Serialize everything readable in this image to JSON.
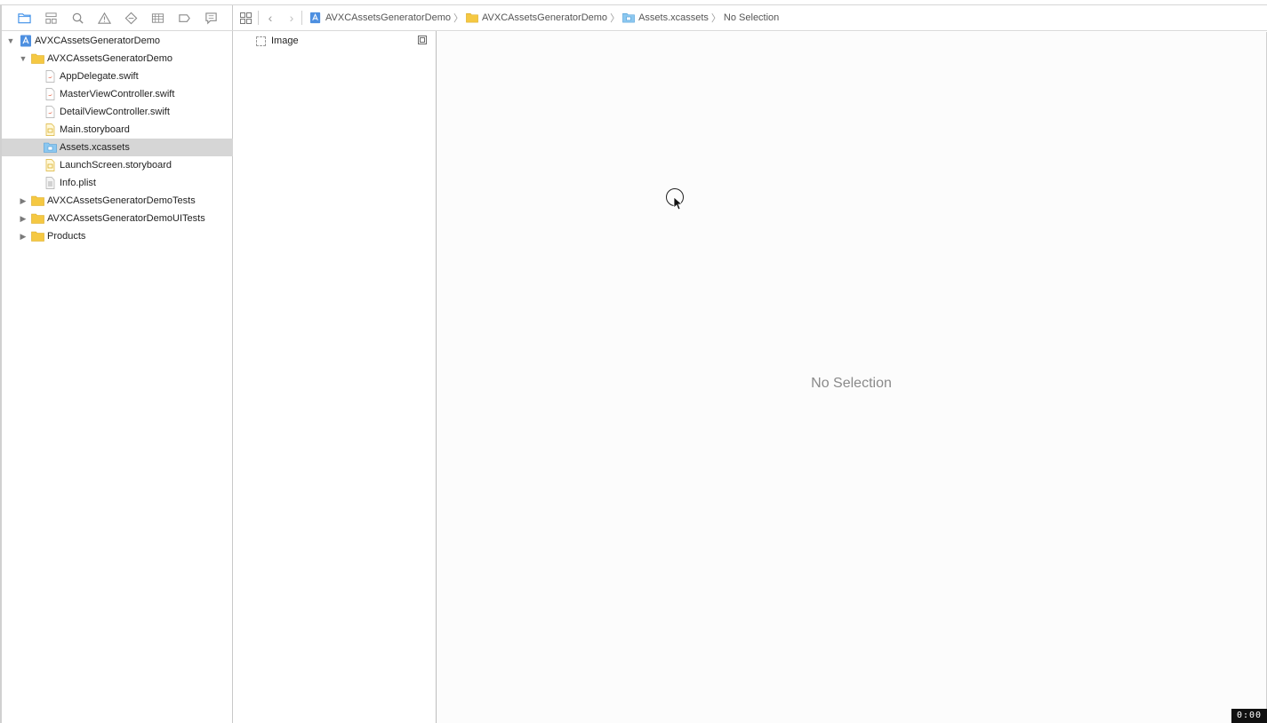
{
  "navigator": {
    "toolbar_icons": [
      "folder-icon",
      "hierarchy-icon",
      "search-icon",
      "warning-icon",
      "diamond-icon",
      "tests-icon",
      "breakpoint-icon",
      "report-icon"
    ],
    "items": [
      {
        "label": "AVXCAssetsGeneratorDemo",
        "type": "project",
        "level": 0,
        "disclosure": "open"
      },
      {
        "label": "AVXCAssetsGeneratorDemo",
        "type": "folder",
        "level": 1,
        "disclosure": "open"
      },
      {
        "label": "AppDelegate.swift",
        "type": "swift",
        "level": 2
      },
      {
        "label": "MasterViewController.swift",
        "type": "swift",
        "level": 2
      },
      {
        "label": "DetailViewController.swift",
        "type": "swift",
        "level": 2
      },
      {
        "label": "Main.storyboard",
        "type": "storyboard",
        "level": 2
      },
      {
        "label": "Assets.xcassets",
        "type": "xcassets",
        "level": 2,
        "selected": true
      },
      {
        "label": "LaunchScreen.storyboard",
        "type": "storyboard",
        "level": 2
      },
      {
        "label": "Info.plist",
        "type": "plist",
        "level": 2
      },
      {
        "label": "AVXCAssetsGeneratorDemoTests",
        "type": "folder",
        "level": 1,
        "disclosure": "closed"
      },
      {
        "label": "AVXCAssetsGeneratorDemoUITests",
        "type": "folder",
        "level": 1,
        "disclosure": "closed"
      },
      {
        "label": "Products",
        "type": "folder",
        "level": 1,
        "disclosure": "closed"
      }
    ]
  },
  "jumpbar": {
    "crumbs": [
      {
        "label": "AVXCAssetsGeneratorDemo",
        "icon": "project-icon"
      },
      {
        "label": "AVXCAssetsGeneratorDemo",
        "icon": "folder-icon"
      },
      {
        "label": "Assets.xcassets",
        "icon": "xcassets-icon"
      },
      {
        "label": "No Selection",
        "icon": ""
      }
    ]
  },
  "assets": {
    "items": [
      {
        "label": "Image"
      }
    ]
  },
  "editor": {
    "placeholder": "No Selection"
  },
  "timer": "0:00",
  "colors": {
    "folder": "#f5c842",
    "selection": "#d6d6d6",
    "accent": "#3b8ee8"
  }
}
